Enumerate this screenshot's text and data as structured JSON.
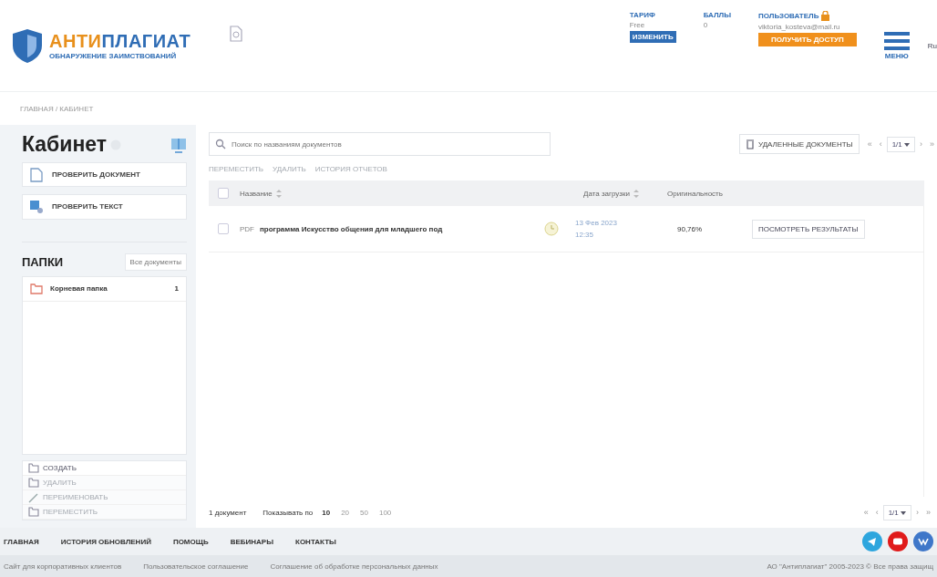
{
  "header": {
    "logo": {
      "title_a": "АНТИ",
      "title_b": "ПЛАГИАТ",
      "subtitle": "ОБНАРУЖЕНИЕ ЗАИМСТВОВАНИЙ"
    },
    "tariff": {
      "label": "ТАРИФ",
      "value": "Free",
      "button": "ИЗМЕНИТЬ"
    },
    "points": {
      "label": "БАЛЛЫ",
      "value": "0"
    },
    "user": {
      "label": "ПОЛЬЗОВАТЕЛЬ",
      "email": "viktoria_kosteva@mail.ru",
      "button": "ПОЛУЧИТЬ ДОСТУП"
    },
    "menu": "МЕНЮ",
    "language": "Ru"
  },
  "breadcrumb": "ГЛАВНАЯ / КАБИНЕТ",
  "sidebar": {
    "title": "Кабинет",
    "actions": [
      {
        "label": "ПРОВЕРИТЬ ДОКУМЕНТ",
        "kind": "document"
      },
      {
        "label": "ПРОВЕРИТЬ ТЕКСТ",
        "kind": "text"
      }
    ],
    "folders_title": "ПАПКИ",
    "all_docs": "Все документы",
    "folders": [
      {
        "name": "Корневая папка",
        "count": "1",
        "selected": true
      }
    ],
    "folder_actions": [
      {
        "label": "СОЗДАТЬ",
        "disabled": false,
        "kind": "create"
      },
      {
        "label": "УДАЛИТЬ",
        "disabled": true,
        "kind": "delete"
      },
      {
        "label": "ПЕРЕИМЕНОВАТЬ",
        "disabled": true,
        "kind": "rename"
      },
      {
        "label": "ПЕРЕМЕСТИТЬ",
        "disabled": true,
        "kind": "move"
      }
    ]
  },
  "toolbar": {
    "search": {
      "placeholder": "Поиск по названиям документов"
    },
    "deleted": "УДАЛЕННЫЕ ДОКУМЕНТЫ",
    "pager": {
      "first": "«",
      "prev": "‹",
      "page": "1/1",
      "next": "›",
      "last": "»"
    },
    "actions": [
      {
        "label": "ПЕРЕМЕСТИТЬ",
        "disabled": true
      },
      {
        "label": "УДАЛИТЬ",
        "disabled": true
      },
      {
        "label": "ИСТОРИЯ ОТЧЕТОВ",
        "disabled": true
      }
    ]
  },
  "table": {
    "select_all_checked": false,
    "columns": [
      "Название",
      "Дата загрузки",
      "Оригинальность"
    ],
    "rows": [
      {
        "checked": false,
        "type": "PDF",
        "name": "программа Искусство общения для младшего под",
        "date": "13 Фев 2023",
        "time": "12:35",
        "originality": "90,76%",
        "button": "ПОСМОТРЕТЬ РЕЗУЛЬТАТЫ"
      }
    ]
  },
  "list_footer": {
    "count": "1 документ",
    "show_label": "Показывать по",
    "sizes": [
      {
        "label": "10",
        "selected": true
      },
      {
        "label": "20",
        "selected": false
      },
      {
        "label": "50",
        "selected": false
      },
      {
        "label": "100",
        "selected": false
      }
    ],
    "pager": {
      "first": "«",
      "prev": "‹",
      "page": "1/1",
      "next": "›",
      "last": "»"
    }
  },
  "footer_nav": [
    "ГЛАВНАЯ",
    "ИСТОРИЯ ОБНОВЛЕНИЙ",
    "ПОМОЩЬ",
    "ВЕБИНАРЫ",
    "КОНТАКТЫ"
  ],
  "footer_links": [
    "Сайт для корпоративных клиентов",
    "Пользовательское соглашение",
    "Соглашение об обработке персональных данных"
  ],
  "copyright": "АО \"Антиплагиат\" 2005-2023 © Все права защищ"
}
